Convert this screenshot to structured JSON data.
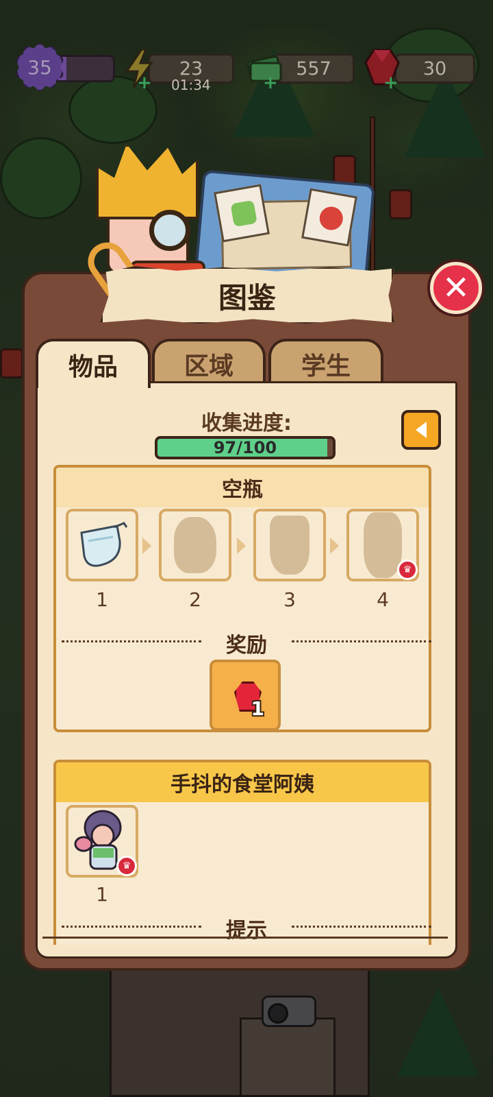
{
  "hud": {
    "level": "35",
    "level_progress": 0.15,
    "energy": "23",
    "energy_timer": "01:34",
    "cash": "557",
    "gems": "30",
    "energy_icon": "lightning-icon",
    "cash_icon": "cash-icon",
    "gem_icon": "ruby-icon"
  },
  "panel": {
    "title": "图鉴",
    "tabs": [
      {
        "label": "物品",
        "active": true
      },
      {
        "label": "区域",
        "active": false
      },
      {
        "label": "学生",
        "active": false
      }
    ],
    "progress_label": "收集进度:",
    "progress_text": "97/100",
    "progress_value": 0.97
  },
  "item_card": {
    "title": "空瓶",
    "slots": [
      {
        "number": "1",
        "unlocked": true
      },
      {
        "number": "2",
        "unlocked": false
      },
      {
        "number": "3",
        "unlocked": false
      },
      {
        "number": "4",
        "unlocked": false,
        "crown": true
      }
    ],
    "reward_label": "奖励",
    "reward": {
      "icon": "ruby-icon",
      "count": "1"
    }
  },
  "npc_card": {
    "title": "手抖的食堂阿姨",
    "slots": [
      {
        "number": "1",
        "crown": true
      }
    ],
    "hint_label": "提示"
  },
  "colors": {
    "panel_brown": "#7a4a38",
    "panel_cream": "#f6e6c7",
    "progress_green": "#5fd08a",
    "close_red": "#e5314a",
    "accent_orange": "#f5a623"
  }
}
